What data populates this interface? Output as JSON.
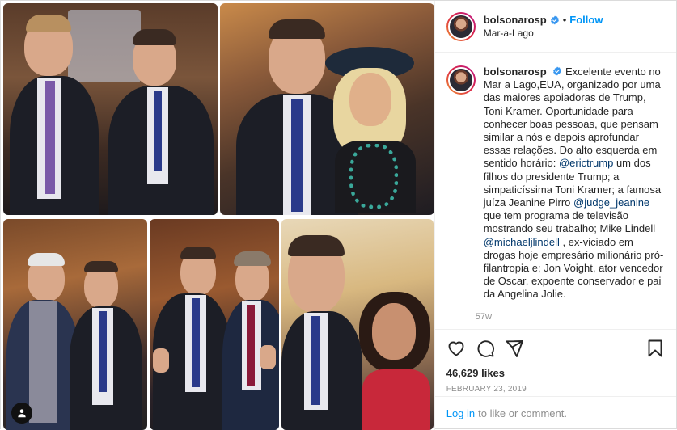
{
  "post": {
    "username": "bolsonarosp",
    "location": "Mar-a-Lago",
    "follow_label": "Follow",
    "separator": "•"
  },
  "caption": {
    "username": "bolsonarosp",
    "parts": {
      "p1": "Excelente evento no Mar a Lago,EUA, organizado por uma das maiores apoiadoras de Trump, Toni Kramer. Oportunidade para conhecer boas pessoas, que pensam similar a nós e depois aprofundar essas relações. Do alto esquerda em sentido horário: ",
      "m1": "@erictrump",
      "p2": " um dos filhos do presidente Trump; a simpaticíssima Toni Kramer; a famosa juíza Jeanine Pirro ",
      "m2": "@judge_jeanine",
      "p3": " que tem programa de televisão mostrando seu trabalho; Mike Lindell ",
      "m3": "@michaeljlindell",
      "p4": " , ex-viciado em drogas hoje empresário milionário pró-filantropia e; Jon Voight, ator vencedor de Oscar, expoente conservador e pai da Angelina Jolie."
    },
    "time_ago": "57w"
  },
  "stats": {
    "likes": "46,629 likes",
    "date": "FEBRUARY 23, 2019"
  },
  "footer": {
    "login_label": "Log in",
    "rest": "to like or comment."
  },
  "icons": {
    "like": "heart-icon",
    "comment": "comment-icon",
    "share": "share-icon",
    "save": "bookmark-icon",
    "verified": "verified-badge-icon",
    "user_tag": "user-tag-icon"
  },
  "colors": {
    "accent": "#0095f6",
    "mention": "#00376b",
    "muted": "#8e8e8e",
    "verified": "#3897f0"
  }
}
